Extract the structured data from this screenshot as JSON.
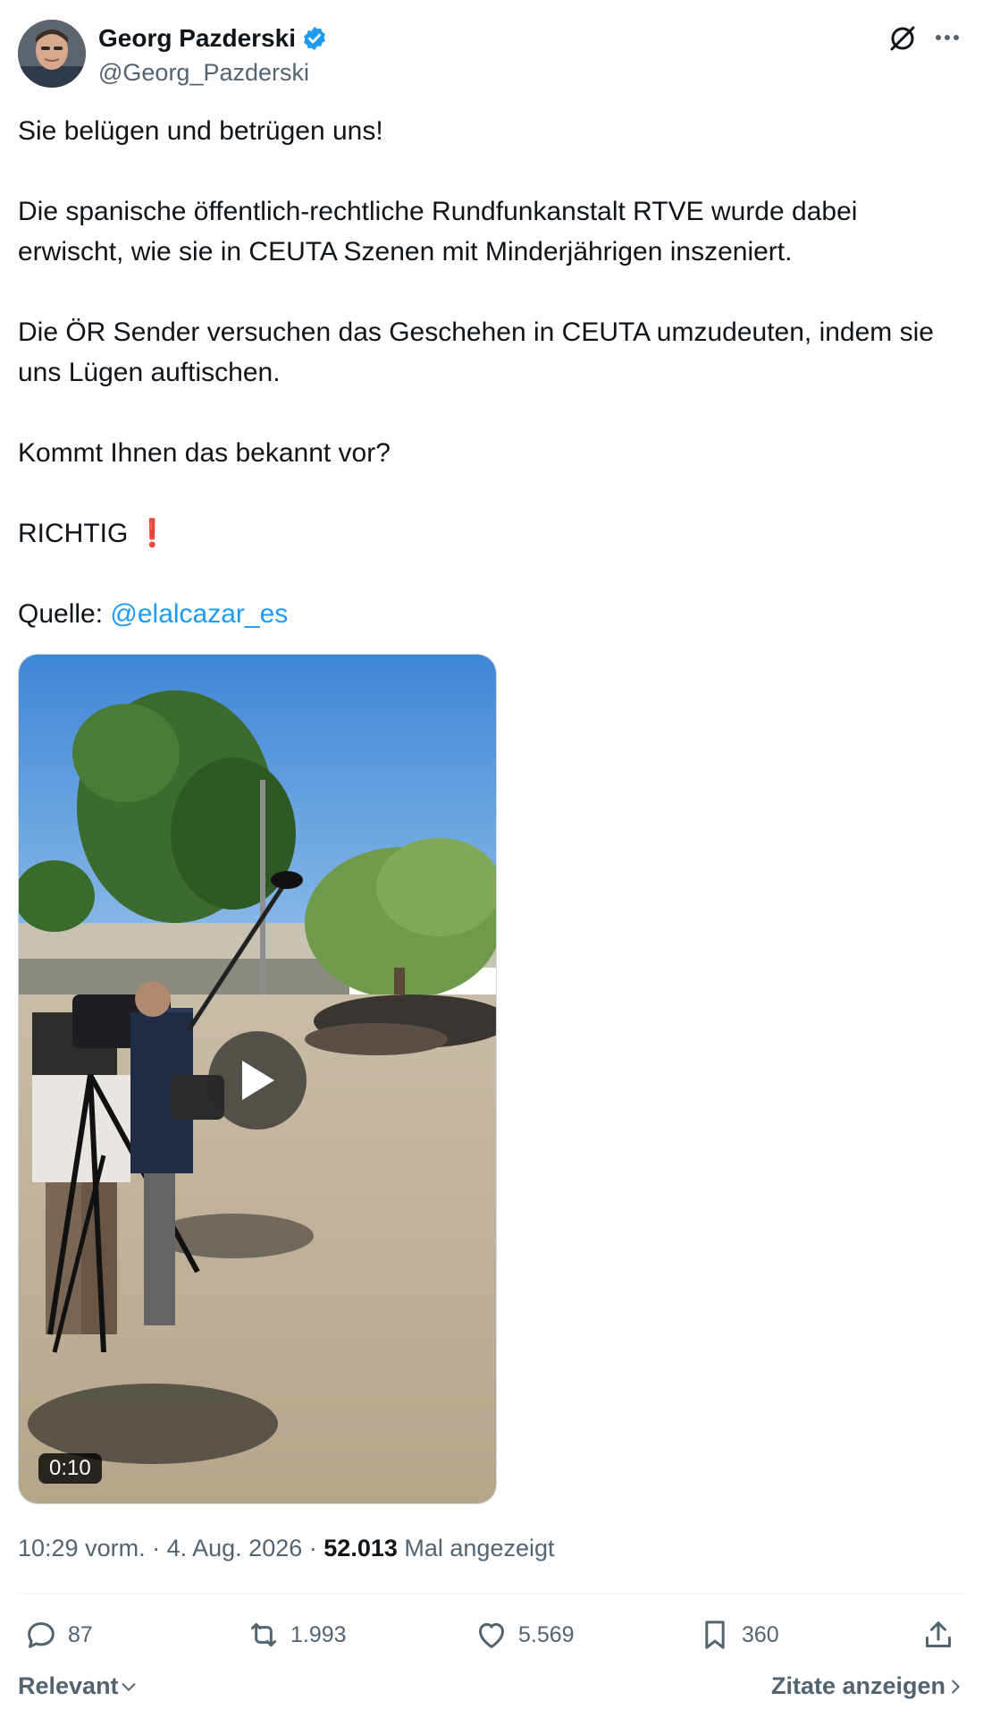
{
  "author": {
    "name": "Georg Pazderski",
    "handle": "@Georg_Pazderski",
    "verified": true
  },
  "tweet": {
    "line1": "Sie belügen und betrügen uns!",
    "line2": "Die spanische öffentlich-rechtliche Rundfunkanstalt RTVE wurde dabei erwischt, wie sie in CEUTA Szenen mit Minderjährigen inszeniert.",
    "line3": "Die ÖR Sender versuchen das Geschehen in CEUTA umzudeuten, indem sie uns Lügen auftischen.",
    "line4": "Kommt Ihnen das bekannt vor?",
    "line5": "RICHTIG",
    "line5_emoji": "❗",
    "source_label": "Quelle:",
    "source_mention": "@elalcazar_es"
  },
  "video": {
    "duration": "0:10"
  },
  "meta": {
    "time": "10:29 vorm.",
    "separator": "·",
    "date": "4. Aug. 2026",
    "views": "52.013",
    "views_label": "Mal angezeigt"
  },
  "actions": {
    "replies": "87",
    "reposts": "1.993",
    "likes": "5.569",
    "bookmarks": "360"
  },
  "footer": {
    "sort_label": "Relevant",
    "quotes_label": "Zitate anzeigen"
  },
  "colors": {
    "accent": "#1d9bf0",
    "muted": "#536471",
    "text": "#0f1419"
  }
}
